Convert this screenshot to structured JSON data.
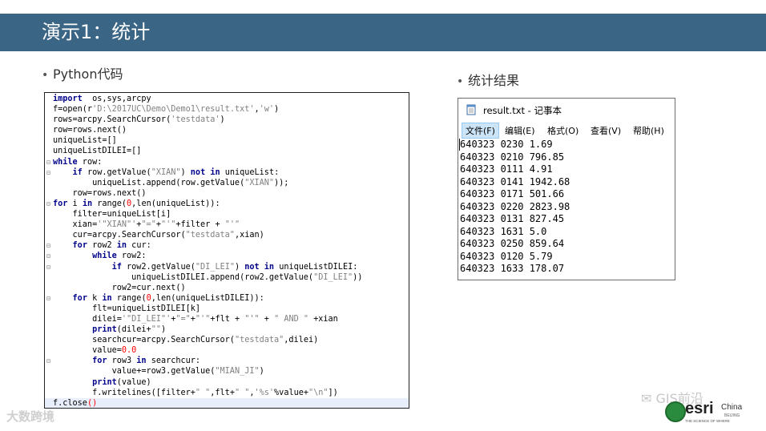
{
  "slide": {
    "title": "演示1：统计",
    "bullet_left": "Python代码",
    "bullet_right": "统计结果",
    "bullet_symbol": "•"
  },
  "code": [
    {
      "fold": "",
      "segs": [
        [
          "kw",
          "import"
        ],
        [
          "",
          "  os,sys,arcpy"
        ]
      ]
    },
    {
      "fold": "",
      "segs": [
        [
          "",
          "f=open(r"
        ],
        [
          "str",
          "'D:\\2017UC\\Demo\\Demo1\\result.txt'"
        ],
        [
          "",
          ","
        ],
        [
          "str",
          "'w'"
        ],
        [
          "",
          ")"
        ]
      ]
    },
    {
      "fold": "",
      "segs": [
        [
          "",
          "rows=arcpy.SearchCursor("
        ],
        [
          "str",
          "'testdata'"
        ],
        [
          "",
          ")"
        ]
      ]
    },
    {
      "fold": "",
      "segs": [
        [
          "",
          "row=rows.next()"
        ]
      ]
    },
    {
      "fold": "",
      "segs": [
        [
          "",
          "uniqueList=[]"
        ]
      ]
    },
    {
      "fold": "",
      "segs": [
        [
          "",
          "uniqueListDILEI=[]"
        ]
      ]
    },
    {
      "fold": "⊟",
      "segs": [
        [
          "kw",
          "while"
        ],
        [
          "",
          " row:"
        ]
      ]
    },
    {
      "fold": "⊟",
      "segs": [
        [
          "",
          "    "
        ],
        [
          "kw",
          "if"
        ],
        [
          "",
          " row.getValue("
        ],
        [
          "str",
          "\"XIAN\""
        ],
        [
          "",
          ") "
        ],
        [
          "kw",
          "not in"
        ],
        [
          "",
          " uniqueList:"
        ]
      ]
    },
    {
      "fold": "",
      "segs": [
        [
          "",
          "        uniqueList.append(row.getValue("
        ],
        [
          "str",
          "\"XIAN\""
        ],
        [
          "",
          "));"
        ]
      ]
    },
    {
      "fold": "",
      "segs": [
        [
          "",
          "    row=rows.next()"
        ]
      ]
    },
    {
      "fold": "⊟",
      "segs": [
        [
          "kw",
          "for"
        ],
        [
          "",
          " i "
        ],
        [
          "kw",
          "in"
        ],
        [
          "",
          " range("
        ],
        [
          "num",
          "0"
        ],
        [
          "",
          ",len(uniqueList)):"
        ]
      ]
    },
    {
      "fold": "",
      "segs": [
        [
          "",
          "    filter=uniqueList[i]"
        ]
      ]
    },
    {
      "fold": "",
      "segs": [
        [
          "",
          "    xian="
        ],
        [
          "str",
          "'\"XIAN\"'"
        ],
        [
          "",
          "+"
        ],
        [
          "str",
          "\"=\""
        ],
        [
          "",
          "+"
        ],
        [
          "str",
          "\"'\""
        ],
        [
          "",
          "+filter + "
        ],
        [
          "str",
          "\"'\""
        ]
      ]
    },
    {
      "fold": "",
      "segs": [
        [
          "",
          "    cur=arcpy.SearchCursor("
        ],
        [
          "str",
          "\"testdata\""
        ],
        [
          "",
          ",xian)"
        ]
      ]
    },
    {
      "fold": "⊟",
      "segs": [
        [
          "",
          "    "
        ],
        [
          "kw",
          "for"
        ],
        [
          "",
          " row2 "
        ],
        [
          "kw",
          "in"
        ],
        [
          "",
          " cur:"
        ]
      ]
    },
    {
      "fold": "⊟",
      "segs": [
        [
          "",
          "        "
        ],
        [
          "kw",
          "while"
        ],
        [
          "",
          " row2:"
        ]
      ]
    },
    {
      "fold": "⊟",
      "segs": [
        [
          "",
          "            "
        ],
        [
          "kw",
          "if"
        ],
        [
          "",
          " row2.getValue("
        ],
        [
          "str",
          "\"DI_LEI\""
        ],
        [
          "",
          ") "
        ],
        [
          "kw",
          "not in"
        ],
        [
          "",
          " uniqueListDILEI:"
        ]
      ]
    },
    {
      "fold": "",
      "segs": [
        [
          "",
          "                uniqueListDILEI.append(row2.getValue("
        ],
        [
          "str",
          "\"DI_LEI\""
        ],
        [
          "",
          "))"
        ]
      ]
    },
    {
      "fold": "",
      "segs": [
        [
          "",
          "            row2=cur.next()"
        ]
      ]
    },
    {
      "fold": "⊟",
      "segs": [
        [
          "",
          "    "
        ],
        [
          "kw",
          "for"
        ],
        [
          "",
          " k "
        ],
        [
          "kw",
          "in"
        ],
        [
          "",
          " range("
        ],
        [
          "num",
          "0"
        ],
        [
          "",
          ",len(uniqueListDILEI)):"
        ]
      ]
    },
    {
      "fold": "",
      "segs": [
        [
          "",
          "        flt=uniqueListDILEI[k]"
        ]
      ]
    },
    {
      "fold": "",
      "segs": [
        [
          "",
          "        dilei="
        ],
        [
          "str",
          "'\"DI_LEI\"'"
        ],
        [
          "",
          "+"
        ],
        [
          "str",
          "\"=\""
        ],
        [
          "",
          "+"
        ],
        [
          "str",
          "\"'\""
        ],
        [
          "",
          "+flt + "
        ],
        [
          "str",
          "\"'\""
        ],
        [
          "",
          " + "
        ],
        [
          "str",
          "\" AND \""
        ],
        [
          "",
          " +xian"
        ]
      ]
    },
    {
      "fold": "",
      "segs": [
        [
          "",
          "        "
        ],
        [
          "kw",
          "print"
        ],
        [
          "",
          "(dilei+"
        ],
        [
          "str",
          "\"\""
        ],
        [
          "",
          ")"
        ]
      ]
    },
    {
      "fold": "",
      "segs": [
        [
          "",
          "        searchcur=arcpy.SearchCursor("
        ],
        [
          "str",
          "\"testdata\""
        ],
        [
          "",
          ",dilei)"
        ]
      ]
    },
    {
      "fold": "",
      "segs": [
        [
          "",
          "        value="
        ],
        [
          "num",
          "0.0"
        ]
      ]
    },
    {
      "fold": "⊟",
      "segs": [
        [
          "",
          "        "
        ],
        [
          "kw",
          "for"
        ],
        [
          "",
          " row3 "
        ],
        [
          "kw",
          "in"
        ],
        [
          "",
          " searchcur:"
        ]
      ]
    },
    {
      "fold": "",
      "segs": [
        [
          "",
          "            value+=row3.getValue("
        ],
        [
          "str",
          "\"MIAN_JI\""
        ],
        [
          "",
          ")"
        ]
      ]
    },
    {
      "fold": "",
      "segs": [
        [
          "",
          "        "
        ],
        [
          "kw",
          "print"
        ],
        [
          "",
          "(value)"
        ]
      ]
    },
    {
      "fold": "",
      "segs": [
        [
          "",
          "        f.writelines([filter+"
        ],
        [
          "str",
          "\" \""
        ],
        [
          "",
          ",flt+"
        ],
        [
          "str",
          "\" \""
        ],
        [
          "",
          ","
        ],
        [
          "str",
          "'%s'"
        ],
        [
          "",
          "%value+"
        ],
        [
          "str",
          "\"\\n\""
        ],
        [
          "",
          "])"
        ]
      ]
    },
    {
      "fold": "",
      "segs": [
        [
          "",
          "f.close"
        ],
        [
          "num",
          "()"
        ]
      ]
    }
  ],
  "notepad": {
    "title": "result.txt - 记事本",
    "menu": [
      "文件(F)",
      "编辑(E)",
      "格式(O)",
      "查看(V)",
      "帮助(H)"
    ],
    "lines": [
      "640323 0230 1.69",
      "640323 0210 796.85",
      "640323 0111 4.91",
      "640323 0141 1942.68",
      "640323 0171 501.66",
      "640323 0220 2823.98",
      "640323 0131 827.45",
      "640323 1631 5.0",
      "640323 0250 859.64",
      "640323 0120 5.79",
      "640323 1633 178.07"
    ]
  },
  "watermarks": {
    "left": "大数跨境",
    "wechat": "GIS前沿"
  },
  "logo": {
    "word": "esri",
    "region": "China",
    "city": "BEIJING",
    "tagline": "THE SCIENCE OF WHERE"
  },
  "colors": {
    "title_bar": "#3b6584",
    "keyword": "#00008b",
    "string": "#808080",
    "number": "#ff0000"
  }
}
